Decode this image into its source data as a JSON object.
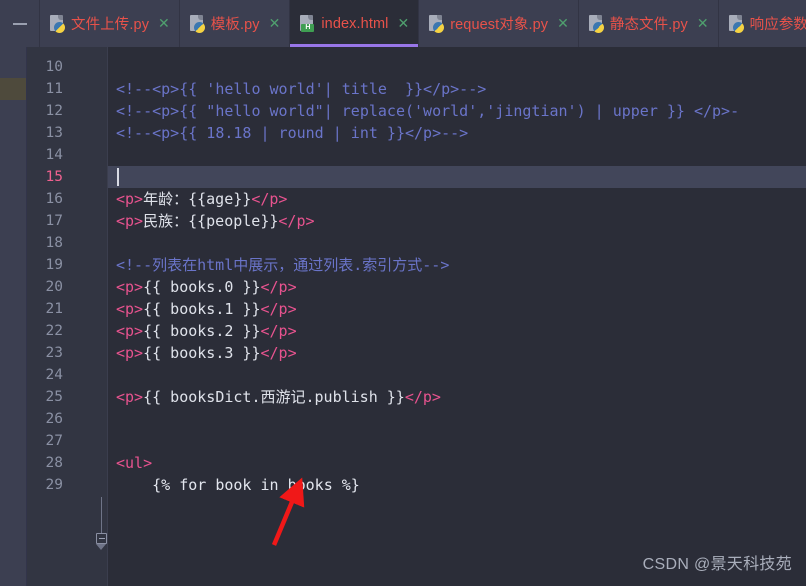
{
  "window": {
    "hide_button_label": "—"
  },
  "tabs": [
    {
      "label": "文件上传.py",
      "icon": "python-file-icon",
      "active": false,
      "close": "✕"
    },
    {
      "label": "模板.py",
      "icon": "python-file-icon",
      "active": false,
      "close": "✕"
    },
    {
      "label": "index.html",
      "icon": "html-file-icon",
      "active": true,
      "close": "✕",
      "badge": "H"
    },
    {
      "label": "request对象.py",
      "icon": "python-file-icon",
      "active": false,
      "close": "✕"
    },
    {
      "label": "静态文件.py",
      "icon": "python-file-icon",
      "active": false,
      "close": "✕"
    },
    {
      "label": "响应参数.",
      "icon": "python-file-icon",
      "active": false,
      "close": ""
    }
  ],
  "editor": {
    "current_line": 15,
    "first_line": 10,
    "line_numbers": [
      "10",
      "11",
      "12",
      "13",
      "14",
      "15",
      "16",
      "17",
      "18",
      "19",
      "20",
      "21",
      "22",
      "23",
      "24",
      "25",
      "26",
      "27",
      "28",
      "29"
    ],
    "lines": [
      {
        "n": "10",
        "segments": []
      },
      {
        "n": "11",
        "segments": [
          {
            "cls": "cmt",
            "t": "<!--<p>{{ 'hello world'| title  }}</p>-->"
          }
        ]
      },
      {
        "n": "12",
        "segments": [
          {
            "cls": "cmt",
            "t": "<!--<p>{{ \"hello world\"| replace('world','jingtian') | upper }} </p>-"
          }
        ]
      },
      {
        "n": "13",
        "segments": [
          {
            "cls": "cmt",
            "t": "<!--<p>{{ 18.18 | round | int }}</p>-->"
          }
        ]
      },
      {
        "n": "14",
        "segments": []
      },
      {
        "n": "15",
        "segments": []
      },
      {
        "n": "16",
        "segments": [
          {
            "cls": "tag",
            "t": "<p>"
          },
          {
            "cls": "txt",
            "t": "年龄：{{age}}"
          },
          {
            "cls": "tag",
            "t": "</p>"
          }
        ]
      },
      {
        "n": "17",
        "segments": [
          {
            "cls": "tag",
            "t": "<p>"
          },
          {
            "cls": "txt",
            "t": "民族：{{people}}"
          },
          {
            "cls": "tag",
            "t": "</p>"
          }
        ]
      },
      {
        "n": "18",
        "segments": []
      },
      {
        "n": "19",
        "segments": [
          {
            "cls": "cmt",
            "t": "<!--列表在html中展示，通过列表.索引方式-->"
          }
        ]
      },
      {
        "n": "20",
        "segments": [
          {
            "cls": "tag",
            "t": "<p>"
          },
          {
            "cls": "txt",
            "t": "{{ books.0 }}"
          },
          {
            "cls": "tag",
            "t": "</p>"
          }
        ]
      },
      {
        "n": "21",
        "segments": [
          {
            "cls": "tag",
            "t": "<p>"
          },
          {
            "cls": "txt",
            "t": "{{ books.1 }}"
          },
          {
            "cls": "tag",
            "t": "</p>"
          }
        ]
      },
      {
        "n": "22",
        "segments": [
          {
            "cls": "tag",
            "t": "<p>"
          },
          {
            "cls": "txt",
            "t": "{{ books.2 }}"
          },
          {
            "cls": "tag",
            "t": "</p>"
          }
        ]
      },
      {
        "n": "23",
        "segments": [
          {
            "cls": "tag",
            "t": "<p>"
          },
          {
            "cls": "txt",
            "t": "{{ books.3 }}"
          },
          {
            "cls": "tag",
            "t": "</p>"
          }
        ]
      },
      {
        "n": "24",
        "segments": []
      },
      {
        "n": "25",
        "segments": [
          {
            "cls": "tag",
            "t": "<p>"
          },
          {
            "cls": "txt",
            "t": "{{ booksDict.西游记.publish }}"
          },
          {
            "cls": "tag",
            "t": "</p>"
          }
        ]
      },
      {
        "n": "26",
        "segments": []
      },
      {
        "n": "27",
        "segments": []
      },
      {
        "n": "28",
        "segments": [
          {
            "cls": "tag",
            "t": "<ul>"
          }
        ],
        "fold": true
      },
      {
        "n": "29",
        "segments": [
          {
            "cls": "plain",
            "t": "    {% for book in books %}"
          }
        ]
      }
    ]
  },
  "annotation": {
    "arrow_color": "#f01818",
    "points_at": "西游记"
  },
  "watermark": {
    "text": "CSDN @景天科技苑"
  }
}
